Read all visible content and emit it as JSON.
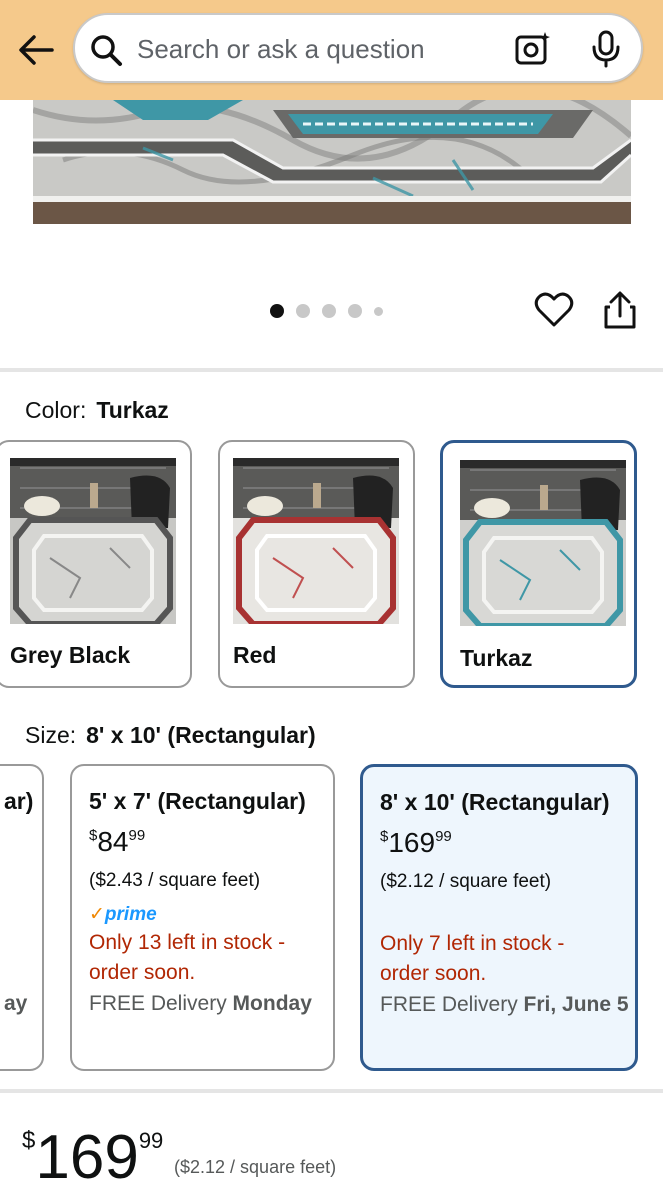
{
  "header": {
    "search_placeholder": "Search or ask a question"
  },
  "image_gallery": {
    "slide_count": 5,
    "active_slide": 1
  },
  "color": {
    "label": "Color:",
    "selected": "Turkaz",
    "options": [
      {
        "name": "Grey Black",
        "border_color": "#555555"
      },
      {
        "name": "Red",
        "border_color": "#a83232"
      },
      {
        "name": "Turkaz",
        "border_color": "#3f97a6"
      }
    ]
  },
  "size": {
    "label": "Size:",
    "selected": "8' x 10' (Rectangular)",
    "partial_prev": {
      "title": "ar)",
      "delivery": "ay"
    },
    "options": [
      {
        "title": "5' x 7' (Rectangular)",
        "currency": "$",
        "price_whole": "84",
        "price_fraction": "99",
        "unit_price": "($2.43 / square feet)",
        "prime": "prime",
        "stock": "Only 13 left in stock - order soon.",
        "delivery_prefix": "FREE Delivery",
        "delivery_day": "Monday"
      },
      {
        "title": "8' x 10' (Rectangular)",
        "currency": "$",
        "price_whole": "169",
        "price_fraction": "99",
        "unit_price": "($2.12 / square feet)",
        "stock": "Only 7 left in stock - order soon.",
        "delivery_prefix": "FREE Delivery",
        "delivery_day": "Fri, June 5"
      }
    ]
  },
  "buy_box": {
    "currency": "$",
    "price_whole": "169",
    "price_fraction": "99",
    "unit_price": "($2.12 / square feet)"
  },
  "colors": {
    "header_bg": "#f5c98b",
    "selected_border": "#2f5a8e",
    "stock_red": "#b12704",
    "prime_blue": "#1a98ff"
  }
}
